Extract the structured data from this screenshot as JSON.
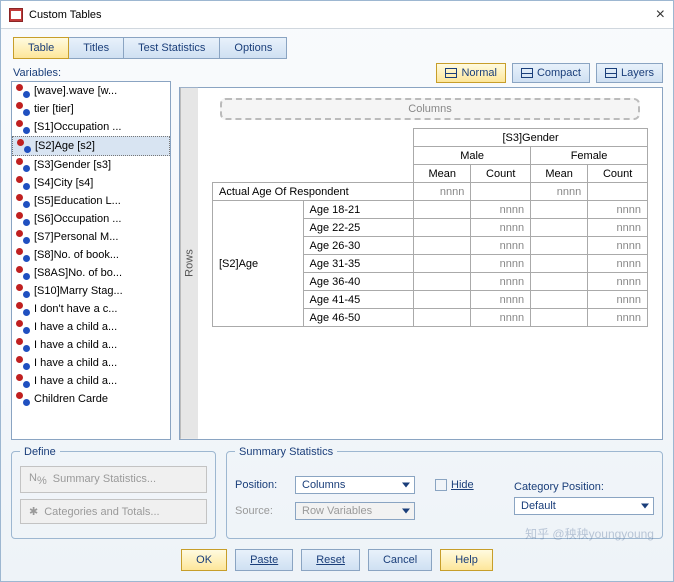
{
  "window": {
    "title": "Custom Tables",
    "close": "×"
  },
  "tabs": {
    "items": [
      "Table",
      "Titles",
      "Test Statistics",
      "Options"
    ],
    "active": 0
  },
  "variables": {
    "label": "Variables:",
    "items": [
      "[wave].wave [w...",
      "tier [tier]",
      "[S1]Occupation ...",
      "[S2]Age [s2]",
      "[S3]Gender [s3]",
      "[S4]City [s4]",
      "[S5]Education L...",
      "[S6]Occupation ...",
      "[S7]Personal M...",
      "[S8]No. of book...",
      "[S8AS]No. of bo...",
      "[S10]Marry Stag...",
      "I don't have a c...",
      "I have a child a...",
      "I have a child a...",
      "I have a child a...",
      "I have a child a...",
      "Children Carde"
    ],
    "selected": 3
  },
  "toolbar": {
    "normal": "Normal",
    "compact": "Compact",
    "layers": "Layers"
  },
  "canvas": {
    "rows_label": "Rows",
    "columns_label": "Columns",
    "col_header": "[S3]Gender",
    "col_groups": [
      "Male",
      "Female"
    ],
    "stats": [
      "Mean",
      "Count"
    ],
    "row_top": "Actual Age Of Respondent",
    "row_group": "[S2]Age",
    "row_cats": [
      "Age 18-21",
      "Age 22-25",
      "Age 26-30",
      "Age 31-35",
      "Age 36-40",
      "Age 41-45",
      "Age 46-50"
    ],
    "placeholder": "nnnn"
  },
  "define": {
    "title": "Define",
    "btn1": "Summary Statistics...",
    "btn2": "Categories and Totals..."
  },
  "summary": {
    "title": "Summary Statistics",
    "position_label": "Position:",
    "position_value": "Columns",
    "hide": "Hide",
    "source_label": "Source:",
    "source_value": "Row Variables",
    "cat_pos_label": "Category Position:",
    "cat_pos_value": "Default"
  },
  "buttons": {
    "ok": "OK",
    "paste": "Paste",
    "reset": "Reset",
    "cancel": "Cancel",
    "help": "Help"
  },
  "watermark": "知乎 @秧秧youngyoung"
}
